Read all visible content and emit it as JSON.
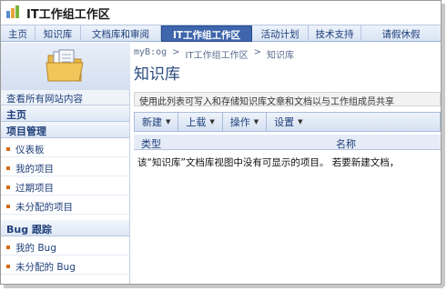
{
  "site": {
    "title": "IT工作组工作区",
    "logo_icon": "sharepoint-logo-icon"
  },
  "top_nav": [
    {
      "label": "主页",
      "active": false
    },
    {
      "label": "知识库",
      "active": false
    },
    {
      "label": "文档库和审阅",
      "active": false
    },
    {
      "label": "IT工作组工作区",
      "active": true
    },
    {
      "label": "活动计划",
      "active": false
    },
    {
      "label": "技术支持",
      "active": false
    },
    {
      "label": "请假休假",
      "active": false
    }
  ],
  "header": {
    "icon": "document-library-folder-icon",
    "breadcrumb": [
      "myB:og",
      ">",
      "IT工作组工作区",
      ">",
      "知识库"
    ],
    "title": "知识库"
  },
  "left_nav": {
    "view_all": "查看所有网站内容",
    "home": "主页",
    "sections": [
      {
        "heading": "项目管理",
        "items": [
          "仪表板",
          "我的项目",
          "过期项目",
          "未分配的项目"
        ]
      },
      {
        "heading": "Bug 跟踪",
        "items": [
          "我的 Bug",
          "未分配的 Bug"
        ]
      }
    ]
  },
  "content": {
    "description": "使用此列表可写入和存储知识库文章和文档以与工作组成员共享",
    "toolbar": [
      {
        "label": "新建",
        "caret": "▼"
      },
      {
        "label": "上载",
        "caret": "▼"
      },
      {
        "label": "操作",
        "caret": "▼"
      },
      {
        "label": "设置",
        "caret": "▼"
      }
    ],
    "columns": {
      "type": "类型",
      "name": "名称"
    },
    "empty_message": "该“知识库”文档库视图中没有可显示的项目。 若要新建文档，"
  },
  "colors": {
    "nav_active_bg": "#3f66ac",
    "link": "#1f3f7a",
    "bullet": "#d66a14",
    "title": "#2b4a7e"
  }
}
